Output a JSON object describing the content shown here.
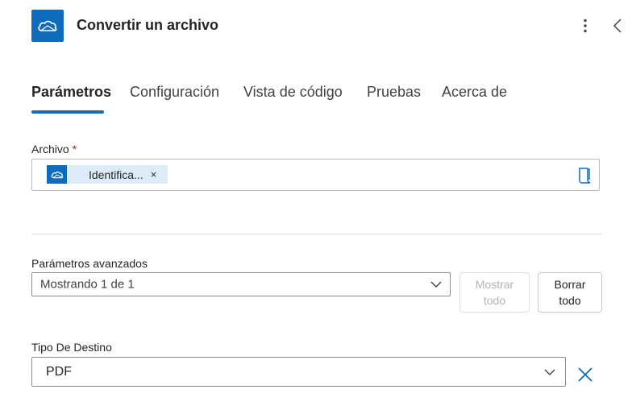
{
  "header": {
    "title": "Convertir un archivo",
    "app_icon": "onedrive-cloud-icon",
    "more_icon": "more-vertical-icon",
    "collapse_icon": "chevron-left-icon"
  },
  "tabs": [
    {
      "label": "Parámetros",
      "active": true
    },
    {
      "label": "Configuración",
      "active": false
    },
    {
      "label": "Vista de código",
      "active": false
    },
    {
      "label": "Pruebas",
      "active": false
    },
    {
      "label": "Acerca de",
      "active": false
    }
  ],
  "file_field": {
    "label": "Archivo",
    "required_mark": "*",
    "token_text": "Identifica...",
    "token_close": "×",
    "token_icon": "onedrive-cloud-icon",
    "picker_icon": "file-picker-icon"
  },
  "advanced": {
    "label": "Parámetros avanzados",
    "selected": "Mostrando 1 de 1",
    "show_all": "Mostrar todo",
    "clear_all": "Borrar todo"
  },
  "destination": {
    "label": "Tipo De Destino",
    "selected": "PDF"
  },
  "colors": {
    "accent": "#0f6cbd",
    "required": "#c50f1f",
    "token_bg": "#deecf9"
  }
}
